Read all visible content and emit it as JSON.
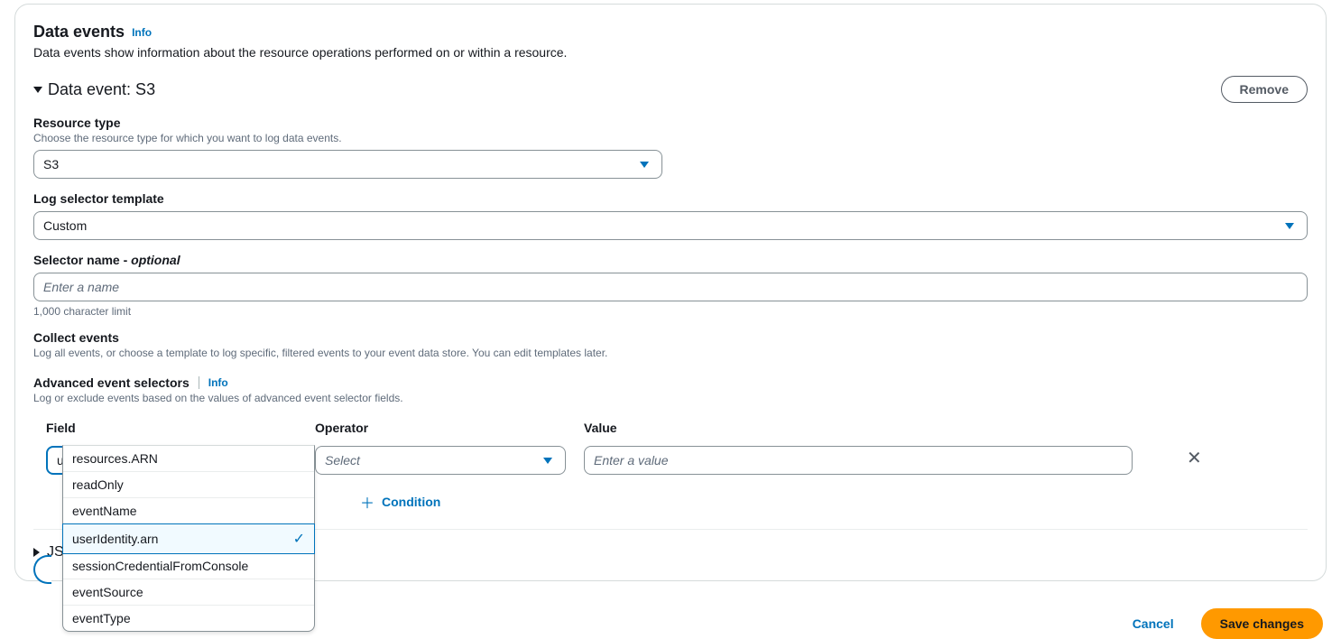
{
  "panel": {
    "title": "Data events",
    "info_link": "Info",
    "description": "Data events show information about the resource operations performed on or within a resource."
  },
  "data_event": {
    "header": "Data event: S3",
    "remove_label": "Remove"
  },
  "resource_type": {
    "label": "Resource type",
    "description": "Choose the resource type for which you want to log data events.",
    "value": "S3"
  },
  "log_selector": {
    "label": "Log selector template",
    "value": "Custom"
  },
  "selector_name": {
    "label": "Selector name - ",
    "optional_text": "optional",
    "placeholder": "Enter a name",
    "helper": "1,000 character limit"
  },
  "collect_events": {
    "label": "Collect events",
    "description": "Log all events, or choose a template to log specific, filtered events to your event data store. You can edit templates later."
  },
  "advanced": {
    "label": "Advanced event selectors",
    "info_link": "Info",
    "description": "Log or exclude events based on the values of advanced event selector fields."
  },
  "selectors": {
    "field_label": "Field",
    "operator_label": "Operator",
    "value_label": "Value",
    "field_value": "userIdentity.arn",
    "operator_placeholder": "Select",
    "value_placeholder": "Enter a value",
    "add_condition_label": "Condition"
  },
  "dropdown_options": [
    {
      "label": "resources.ARN",
      "selected": false
    },
    {
      "label": "readOnly",
      "selected": false
    },
    {
      "label": "eventName",
      "selected": false
    },
    {
      "label": "userIdentity.arn",
      "selected": true
    },
    {
      "label": "sessionCredentialFromConsole",
      "selected": false
    },
    {
      "label": "eventSource",
      "selected": false
    },
    {
      "label": "eventType",
      "selected": false
    }
  ],
  "json_view": {
    "label": "JSON view"
  },
  "footer": {
    "cancel": "Cancel",
    "save": "Save changes"
  }
}
